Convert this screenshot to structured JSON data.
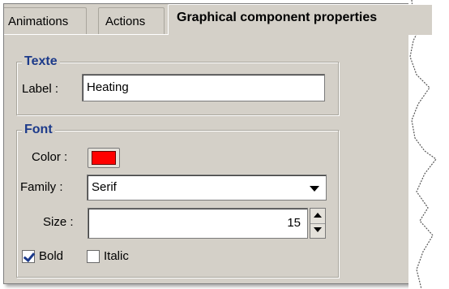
{
  "tabs": [
    {
      "label": "Animations",
      "active": false
    },
    {
      "label": "Actions",
      "active": false
    },
    {
      "label": "Graphical component properties",
      "active": true
    }
  ],
  "texte_group": {
    "title": "Texte",
    "label_caption": "Label :",
    "label_value": "Heating"
  },
  "font_group": {
    "title": "Font",
    "color_caption": "Color :",
    "color_value": "#ff0000",
    "family_caption": "Family :",
    "family_value": "Serif",
    "size_caption": "Size :",
    "size_value": "15",
    "bold_label": "Bold",
    "bold_checked": true,
    "italic_label": "Italic",
    "italic_checked": false
  },
  "icons": [
    "chevron-down-icon",
    "spin-up-icon",
    "spin-down-icon",
    "checkmark-icon"
  ]
}
